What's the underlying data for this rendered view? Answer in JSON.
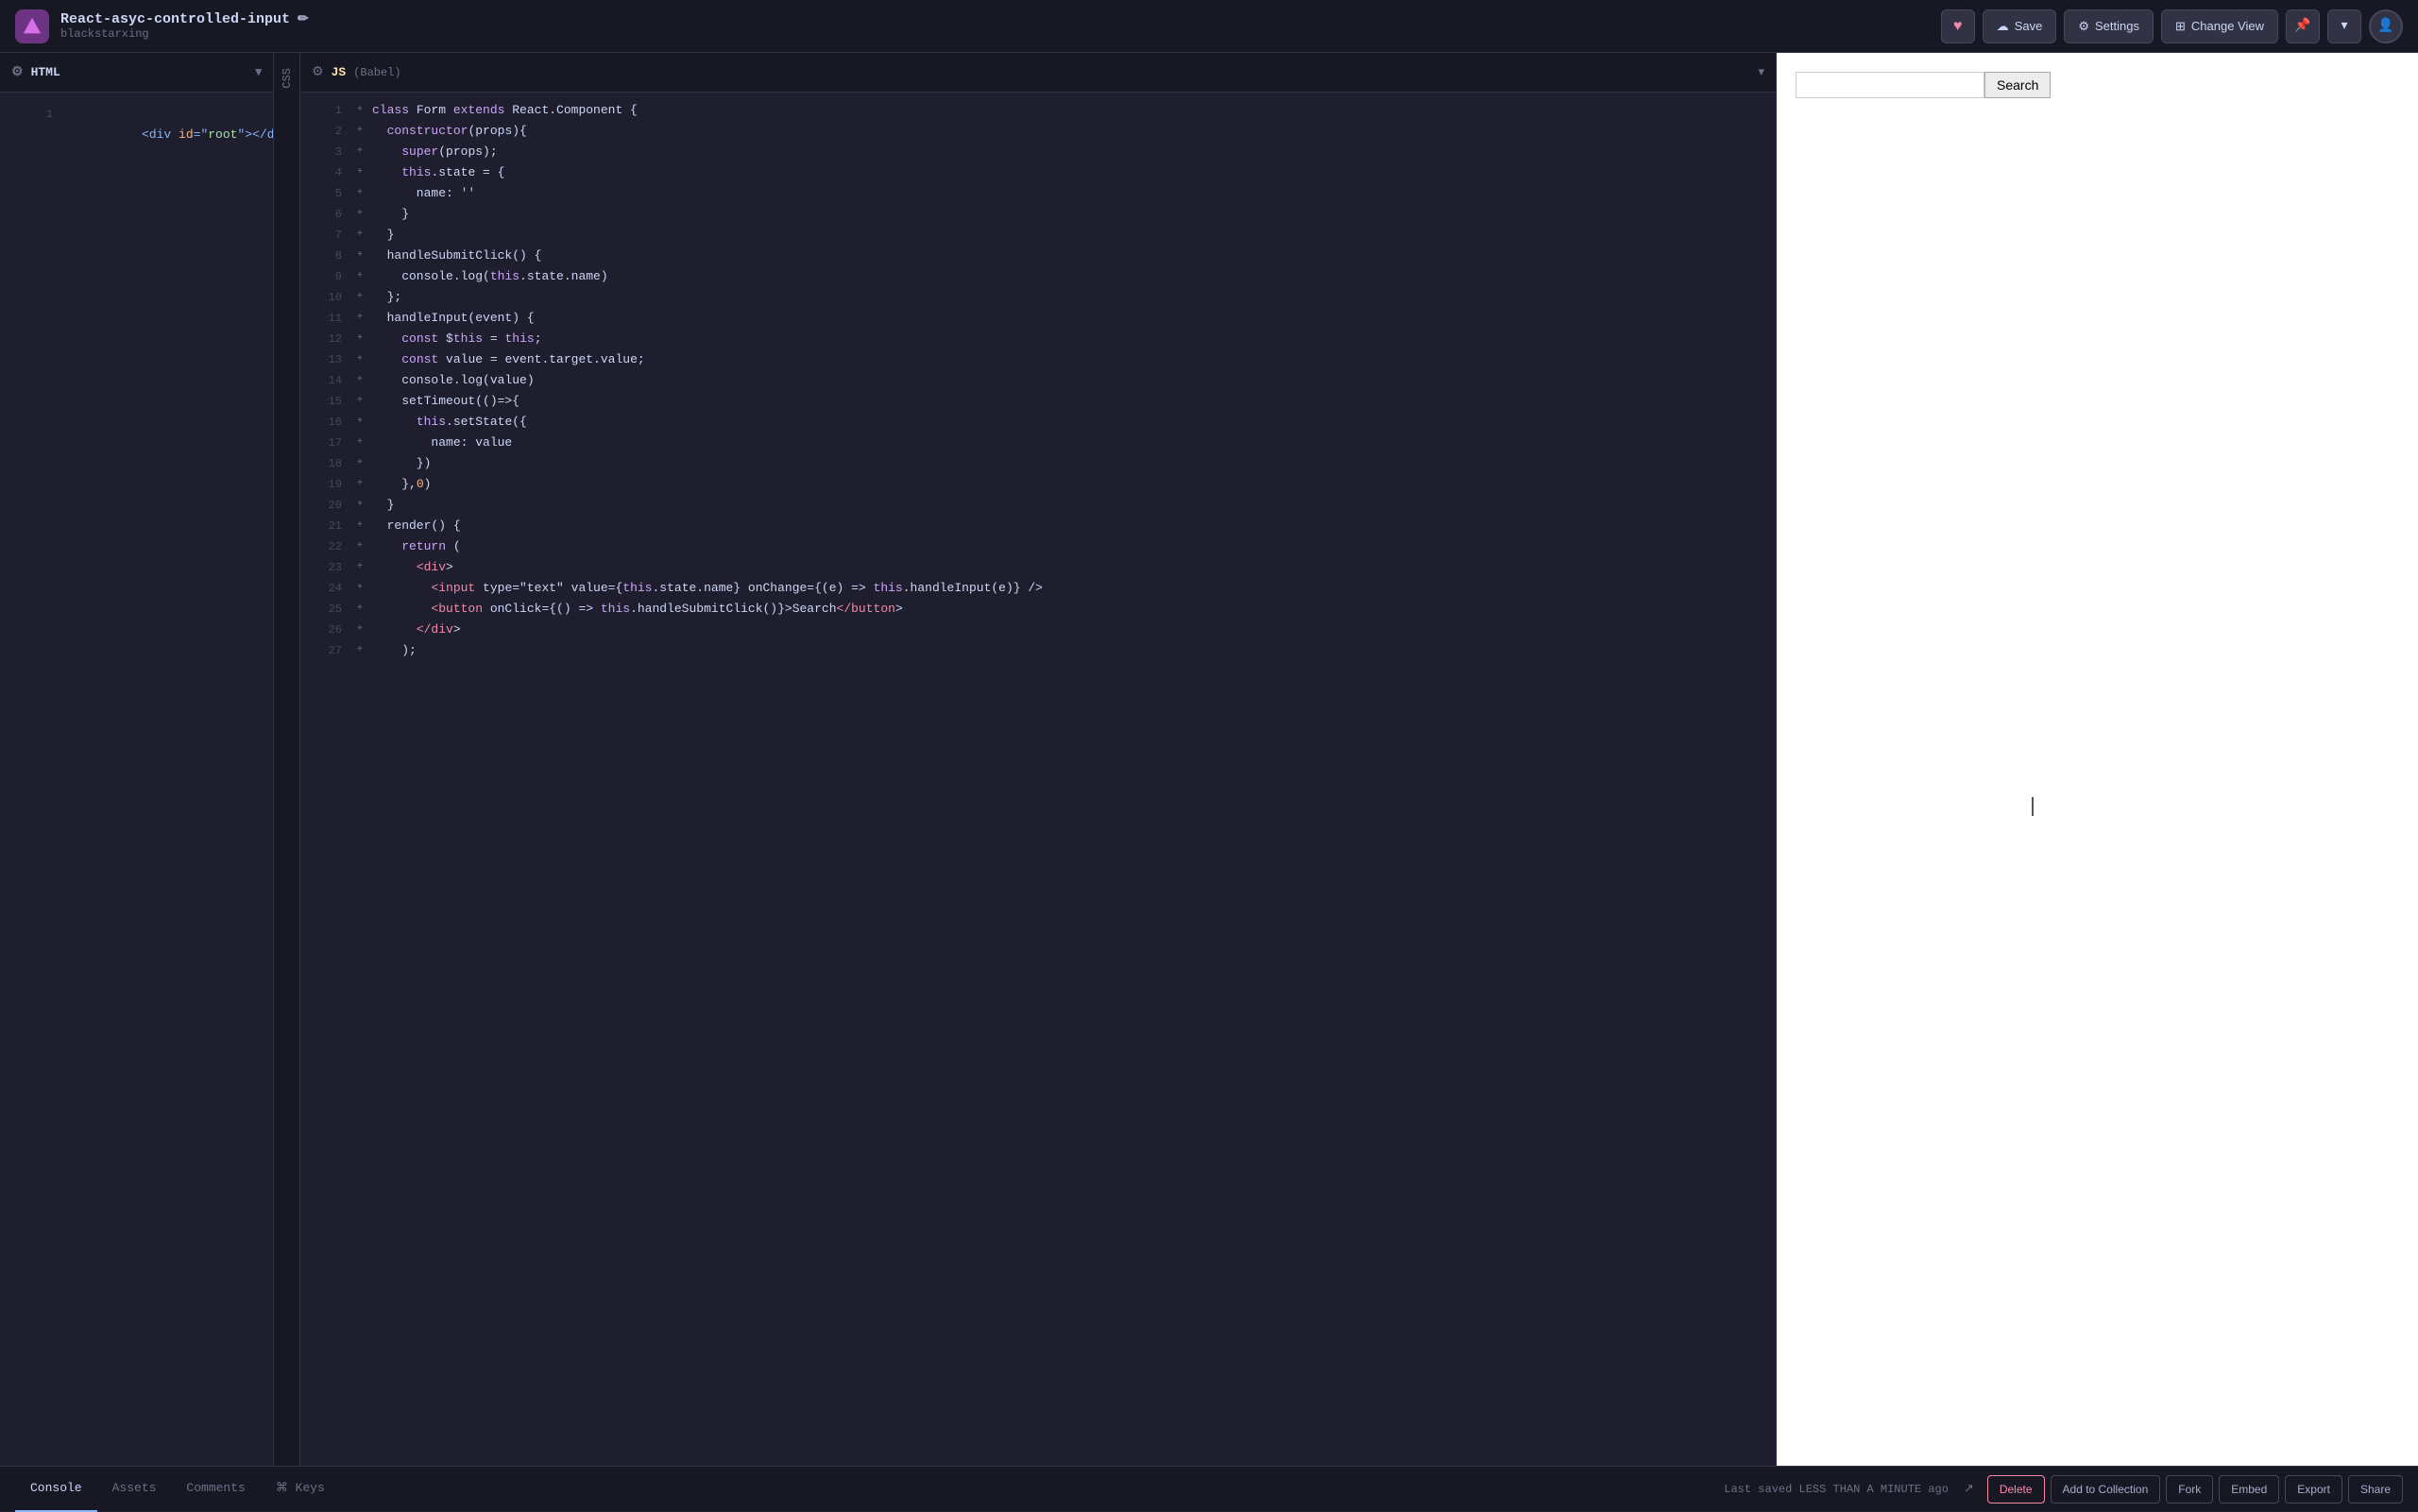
{
  "topbar": {
    "title": "React-asyc-controlled-input",
    "pencil": "✏",
    "subtitle": "blackstarxing",
    "heart_label": "♥",
    "save_label": "Save",
    "settings_label": "Settings",
    "change_view_label": "Change View",
    "pin_icon": "📌",
    "chevron_icon": "▾",
    "avatar_icon": "👤"
  },
  "html_panel": {
    "header_label": "HTML",
    "gear_icon": "⚙",
    "chevron_icon": "▾",
    "code_line": "<div id=\"root\"></div>"
  },
  "css_tab": {
    "label": "CSS"
  },
  "js_panel": {
    "header_label": "JS",
    "babel_label": "(Babel)",
    "chevron_icon": "▾",
    "lines": [
      {
        "num": "1",
        "dot": "▸",
        "text": "class Form extends React.Component {"
      },
      {
        "num": "2",
        "dot": "▸",
        "text": "  constructor(props){"
      },
      {
        "num": "3",
        "dot": "▸",
        "text": "    super(props);"
      },
      {
        "num": "4",
        "dot": "▸",
        "text": "    this.state = {"
      },
      {
        "num": "5",
        "dot": "▸",
        "text": "      name: ''"
      },
      {
        "num": "6",
        "dot": "▸",
        "text": "    }"
      },
      {
        "num": "7",
        "dot": "▸",
        "text": "  }"
      },
      {
        "num": "8",
        "dot": "▸",
        "text": "  handleSubmitClick() {"
      },
      {
        "num": "9",
        "dot": "▸",
        "text": "    console.log(this.state.name)"
      },
      {
        "num": "10",
        "dot": "▸",
        "text": "  };"
      },
      {
        "num": "11",
        "dot": "▸",
        "text": "  handleInput(event) {"
      },
      {
        "num": "12",
        "dot": "▸",
        "text": "    const $this = this;"
      },
      {
        "num": "13",
        "dot": "▸",
        "text": "    const value = event.target.value;"
      },
      {
        "num": "14",
        "dot": "▸",
        "text": "    console.log(value)"
      },
      {
        "num": "15",
        "dot": "▸",
        "text": "    setTimeout(()=>{"
      },
      {
        "num": "16",
        "dot": "▸",
        "text": "      this.setState({"
      },
      {
        "num": "17",
        "dot": "▸",
        "text": "        name: value"
      },
      {
        "num": "18",
        "dot": "▸",
        "text": "      })"
      },
      {
        "num": "19",
        "dot": "▸",
        "text": "    },0)"
      },
      {
        "num": "20",
        "dot": "▸",
        "text": "  }"
      },
      {
        "num": "21",
        "dot": "▸",
        "text": "  render() {"
      },
      {
        "num": "22",
        "dot": "▸",
        "text": "    return ("
      },
      {
        "num": "23",
        "dot": "▸",
        "text": "      <div>"
      },
      {
        "num": "24",
        "dot": "▸",
        "text": "        <input type=\"text\" value={this.state.name} onChange={(e) => this.handleInput(e)} />"
      },
      {
        "num": "25",
        "dot": "▸",
        "text": "        <button onClick={() => this.handleSubmitClick()}>Search</button>"
      },
      {
        "num": "26",
        "dot": "▸",
        "text": "      </div>"
      },
      {
        "num": "27",
        "dot": "▸",
        "text": "    );"
      }
    ]
  },
  "preview": {
    "search_btn_label": "Search",
    "search_placeholder": ""
  },
  "bottom": {
    "tabs": [
      {
        "id": "console",
        "label": "Console",
        "active": true
      },
      {
        "id": "assets",
        "label": "Assets",
        "active": false
      },
      {
        "id": "comments",
        "label": "Comments",
        "active": false
      },
      {
        "id": "keys",
        "label": "⌘ Keys",
        "active": false
      }
    ],
    "status": "Last saved LESS THAN A MINUTE ago",
    "actions": [
      {
        "id": "delete",
        "label": "Delete",
        "danger": true
      },
      {
        "id": "add-to-collection",
        "label": "Add to Collection",
        "danger": false
      },
      {
        "id": "fork",
        "label": "Fork",
        "danger": false
      },
      {
        "id": "embed",
        "label": "Embed",
        "danger": false
      },
      {
        "id": "export",
        "label": "Export",
        "danger": false
      },
      {
        "id": "share",
        "label": "Share",
        "danger": false
      }
    ],
    "external_icon": "↗"
  }
}
